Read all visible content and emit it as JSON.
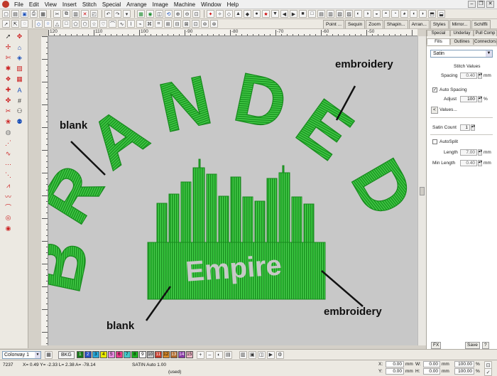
{
  "menubar": {
    "items": [
      "File",
      "Edit",
      "View",
      "Insert",
      "Stitch",
      "Special",
      "Arrange",
      "Image",
      "Machine",
      "Window",
      "Help"
    ]
  },
  "object_tabs": [
    "Point ...",
    "Sequin",
    "Zoom",
    "Shapin...",
    "Arran...",
    "Styles",
    "Mirror...",
    "Schiffli"
  ],
  "ruler": {
    "top_labels": [
      "120",
      "110",
      "100",
      "-90",
      "-80",
      "-70",
      "-60",
      "-50"
    ],
    "left_labels": [
      "40",
      "",
      "30",
      "",
      "20",
      "",
      "10",
      "",
      "0",
      "",
      "-10",
      "",
      "-20",
      "",
      "-30"
    ]
  },
  "design": {
    "word_branded": "BRANDED",
    "word_empire": "Empire",
    "thread_color": "#22b02c"
  },
  "annotations": {
    "top_right": "embroidery",
    "left": "blank",
    "bottom_left": "blank",
    "bottom_right": "embroidery"
  },
  "right_panel": {
    "tabs_row1": [
      "Special",
      "Underlay",
      "Pull Comp"
    ],
    "tabs_row2": [
      "Fills",
      "Outlines",
      "Connectors"
    ],
    "stitch_type": "Satin",
    "stitch_values_label": "Stitch Values",
    "spacing_label": "Spacing",
    "spacing_value": "0.40",
    "spacing_unit": "mm",
    "auto_spacing_label": "Auto Spacing",
    "auto_spacing_checked": "✓",
    "adjust_label": "Adjust",
    "adjust_value": "100",
    "adjust_unit": "%",
    "values_button": "Values...",
    "values_arrow": "<",
    "satin_count_label": "Satin Count",
    "satin_count_value": "1",
    "autosplit_label": "AutoSplit",
    "length_label": "Length",
    "length_value": "7.00",
    "length_unit": "mm",
    "min_length_label": "Min Length",
    "min_length_value": "0.40",
    "min_length_unit": "mm",
    "fx_button": "FX",
    "save_button": "Save",
    "help_button": "?"
  },
  "colorbar": {
    "colorway": "Colorway 1",
    "bkg_label": "BKG",
    "swatches": [
      {
        "label": "1",
        "color": "#1a7a1a"
      },
      {
        "label": "2",
        "color": "#2b4fc0"
      },
      {
        "label": "3",
        "color": "#2aa8d8"
      },
      {
        "label": "4",
        "color": "#e8e800"
      },
      {
        "label": "5",
        "color": "#e88ae0"
      },
      {
        "label": "6",
        "color": "#ea3c8a"
      },
      {
        "label": "7",
        "color": "#44c8c8"
      },
      {
        "label": "8",
        "color": "#20b020"
      },
      {
        "label": "9",
        "color": "#ffffff"
      },
      {
        "label": "10",
        "color": "#c8c8c8"
      },
      {
        "label": "11",
        "color": "#c83a2a"
      },
      {
        "label": "12",
        "color": "#d88a2a"
      },
      {
        "label": "13",
        "color": "#b06a2a"
      },
      {
        "label": "14",
        "color": "#8a3aa8"
      },
      {
        "label": "15",
        "color": "#f0b8c8"
      }
    ]
  },
  "statusbar": {
    "stitch_count": "7237",
    "coords": "X= 0.49 Y= -2.33 L= 2.38 A= -78.14",
    "stitch_info": "SATIN Auto  1.00",
    "used": "(used)",
    "x_label": "X:",
    "x_value": "0.00",
    "x_unit": "mm",
    "y_label": "Y:",
    "y_value": "0.00",
    "y_unit": "mm",
    "w_label": "W:",
    "w_value": "0.00",
    "w_unit": "mm",
    "h_label": "H:",
    "h_value": "0.00",
    "h_unit": "mm",
    "wp_value": "100.00",
    "wp_unit": "%",
    "hp_value": "100.00",
    "hp_unit": "%"
  }
}
